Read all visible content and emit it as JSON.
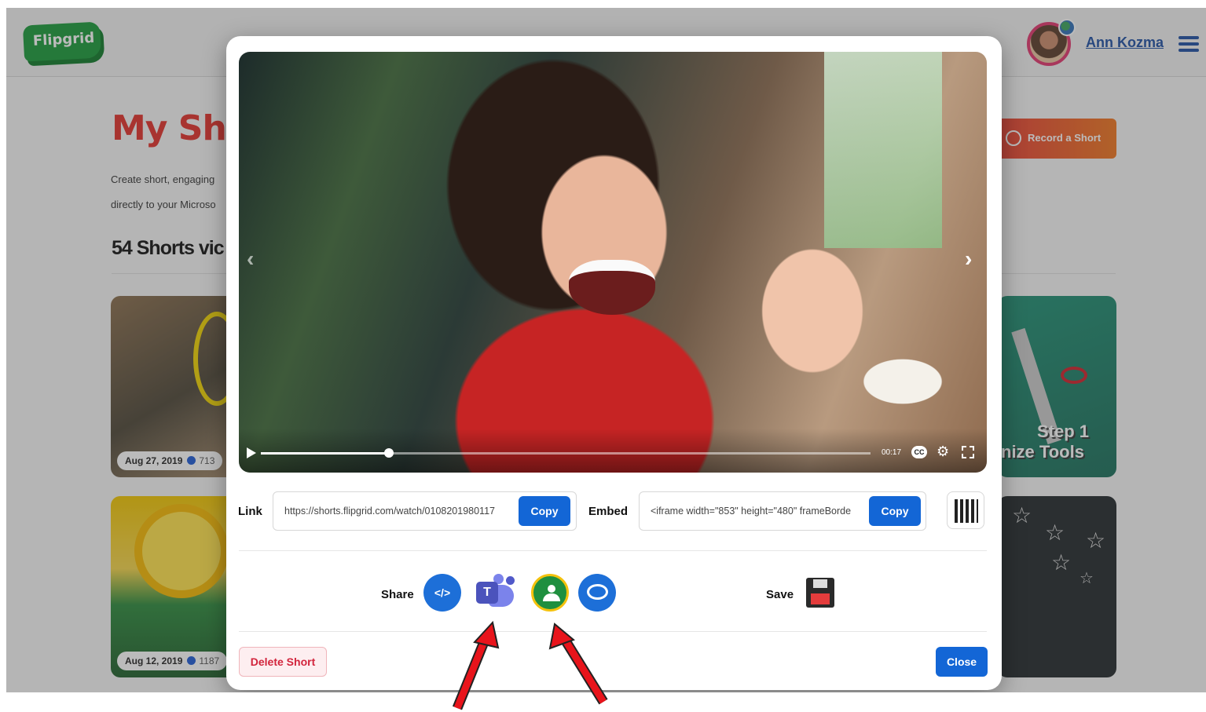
{
  "header": {
    "logo_text": "Flipgrid",
    "user_name": "Ann Kozma"
  },
  "background": {
    "title": "My Short",
    "description_line1": "Create short, engaging",
    "description_line2": "directly to your Microso",
    "count_title": "54 Shorts vic",
    "record_button": "Record a Short",
    "cards": [
      {
        "date": "Aug 27, 2019",
        "views": "713"
      },
      {
        "date": "Aug 12, 2019",
        "views": "1187"
      }
    ],
    "card_step_line1": "Step 1",
    "card_step_line2": "nize Tools"
  },
  "modal": {
    "player": {
      "time": "00:17",
      "cc_label": "CC",
      "progress": 0.21
    },
    "link": {
      "label": "Link",
      "value": "https://shorts.flipgrid.com/watch/0108201980117",
      "copy_label": "Copy"
    },
    "embed": {
      "label": "Embed",
      "value": "<iframe width=\"853\" height=\"480\" frameBorde",
      "copy_label": "Copy"
    },
    "share": {
      "label": "Share",
      "embed_icon_text": "</>",
      "teams_icon_text": "T"
    },
    "save": {
      "label": "Save"
    },
    "delete_label": "Delete Short",
    "close_label": "Close"
  },
  "colors": {
    "primary": "#1366d6",
    "danger": "#d2243c",
    "title_red": "#e2312a",
    "annotation_arrow": "#e8141b"
  }
}
